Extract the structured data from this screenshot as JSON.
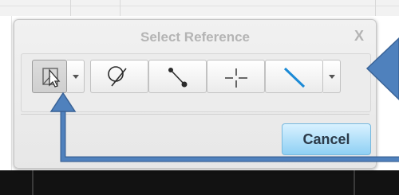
{
  "dialog": {
    "title": "Select Reference",
    "close_label": "X",
    "cancel_label": "Cancel",
    "tools": [
      {
        "name": "select-reference-tool",
        "icon": "select-arrow-icon",
        "active": true,
        "has_dropdown": true
      },
      {
        "name": "curve-tool",
        "icon": "curve-reference-icon",
        "active": false,
        "has_dropdown": false
      },
      {
        "name": "edge-tool",
        "icon": "edge-reference-icon",
        "active": false,
        "has_dropdown": false
      },
      {
        "name": "axis-tool",
        "icon": "axis-reference-icon",
        "active": false,
        "has_dropdown": false
      },
      {
        "name": "line-tool",
        "icon": "line-reference-icon",
        "active": false,
        "has_dropdown": true
      }
    ]
  },
  "annotations": {
    "color": "#4a78b5",
    "items": [
      "callout-arrow-shape",
      "pointer-arrow-icon"
    ]
  },
  "colors": {
    "line_icon_blue": "#1b8ad6",
    "cancel_gradient_top": "#d8f1ff",
    "cancel_gradient_bottom": "#8fd0f4"
  }
}
